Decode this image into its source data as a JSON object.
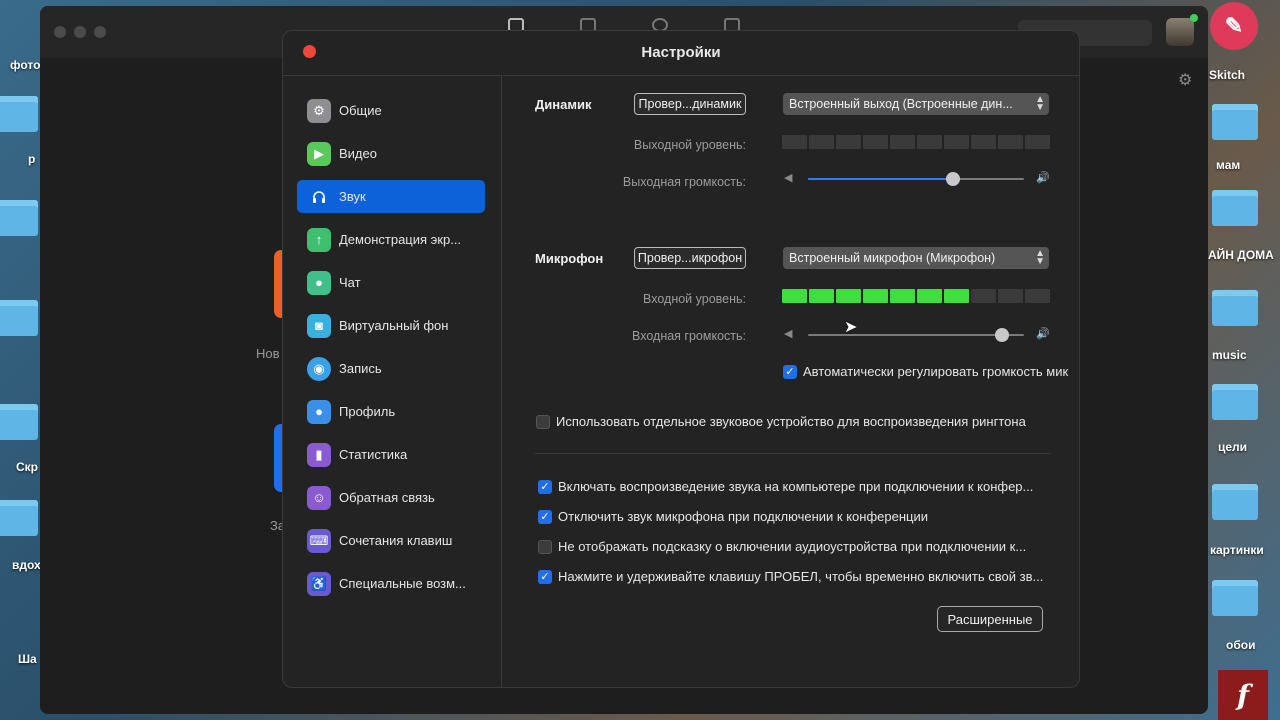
{
  "desktop": {
    "left_labels": [
      "фото",
      "р",
      "Скр",
      "вдох",
      "Ша"
    ],
    "right_labels": [
      "Skitch",
      "мам",
      "АЙН ДОМА",
      "music",
      "цели",
      "картинки",
      "обои"
    ]
  },
  "main_window": {
    "bg_texts": [
      "Нов",
      "За"
    ]
  },
  "dialog": {
    "title": "Настройки"
  },
  "sidebar": {
    "items": [
      {
        "label": "Общие",
        "icon": "gear-icon",
        "color": "#8e8e93"
      },
      {
        "label": "Видео",
        "icon": "video-camera-icon",
        "color": "#5ac85a"
      },
      {
        "label": "Звук",
        "icon": "headphones-icon",
        "color": "#0e62d9"
      },
      {
        "label": "Демонстрация экр...",
        "icon": "screen-share-icon",
        "color": "#3fbf6f"
      },
      {
        "label": "Чат",
        "icon": "chat-bubble-icon",
        "color": "#3fc08a"
      },
      {
        "label": "Виртуальный фон",
        "icon": "virtual-background-icon",
        "color": "#3ab0e0"
      },
      {
        "label": "Запись",
        "icon": "record-icon",
        "color": "#3aa0e8"
      },
      {
        "label": "Профиль",
        "icon": "profile-icon",
        "color": "#3a90e8"
      },
      {
        "label": "Статистика",
        "icon": "statistics-icon",
        "color": "#8a5ad0"
      },
      {
        "label": "Обратная связь",
        "icon": "feedback-smile-icon",
        "color": "#8a5ad0"
      },
      {
        "label": "Сочетания клавиш",
        "icon": "keyboard-icon",
        "color": "#6a5ad0"
      },
      {
        "label": "Специальные возм...",
        "icon": "accessibility-icon",
        "color": "#6a5ad0"
      }
    ],
    "active_index": 2
  },
  "speaker": {
    "label": "Динамик",
    "test_button": "Провер...динамик",
    "device": "Встроенный выход (Встроенные дин...",
    "output_level_label": "Выходной уровень:",
    "output_level_segments_on": 0,
    "output_volume_label": "Выходная громкость:",
    "output_volume": 0.67
  },
  "microphone": {
    "label": "Микрофон",
    "test_button": "Провер...икрофон",
    "device": "Встроенный микрофон (Микрофон)",
    "input_level_label": "Входной уровень:",
    "input_level_segments_on": 7,
    "input_volume_label": "Входная громкость:",
    "input_volume": 0.9,
    "auto_adjust_label": "Автоматически регулировать громкость мик",
    "auto_adjust": true
  },
  "ringtone": {
    "label": "Использовать отдельное звуковое устройство для воспроизведения рингтона",
    "checked": false
  },
  "options": [
    {
      "label": "Включать воспроизведение звука на компьютере при подключении к конфер...",
      "checked": true
    },
    {
      "label": "Отключить звук микрофона при подключении к конференции",
      "checked": true
    },
    {
      "label": "Не отображать подсказку о включении аудиоустройства при подключении к...",
      "checked": false
    },
    {
      "label": "Нажмите и удерживайте клавишу ПРОБЕЛ, чтобы временно включить свой зв...",
      "checked": true
    }
  ],
  "advanced_button": "Расширенные",
  "meter_segments_total": 10
}
